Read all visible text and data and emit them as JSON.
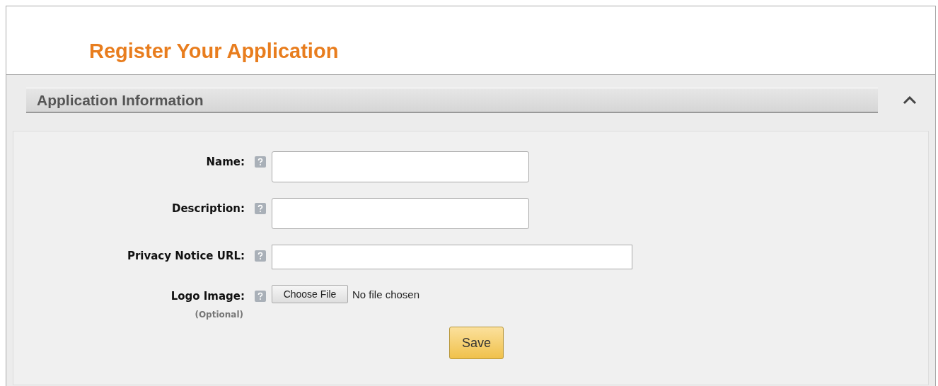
{
  "page": {
    "title": "Register Your Application"
  },
  "section": {
    "title": "Application Information",
    "expanded": true
  },
  "fields": [
    {
      "kind": "text",
      "label": "Name:"
    },
    {
      "kind": "textarea",
      "label": "Description:"
    },
    {
      "kind": "url",
      "label": "Privacy Notice URL:"
    },
    {
      "kind": "file",
      "label": "Logo Image:",
      "note": "(Optional)",
      "button": "Choose File",
      "status": "No file chosen"
    }
  ],
  "buttons": [
    "Save"
  ]
}
